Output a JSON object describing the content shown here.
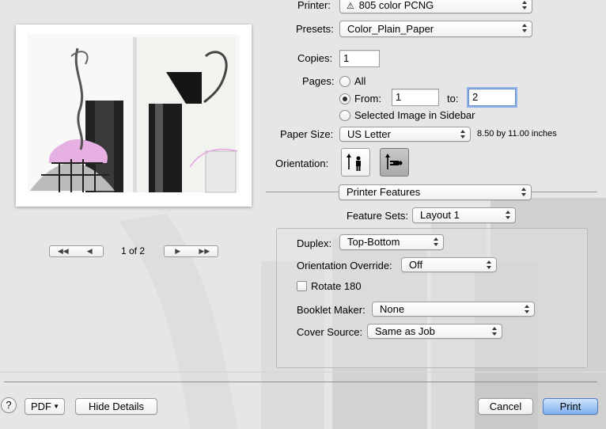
{
  "printer": {
    "label": "Printer:",
    "value": "805 color PCNG",
    "warning_icon": "warning-triangle-icon"
  },
  "presets": {
    "label": "Presets:",
    "value": "Color_Plain_Paper"
  },
  "copies": {
    "label": "Copies:",
    "value": "1"
  },
  "pages": {
    "label": "Pages:",
    "all_label": "All",
    "from_label": "From:",
    "from_value": "1",
    "to_label": "to:",
    "to_value": "2",
    "selected_label": "Selected Image in Sidebar",
    "selected_option": "from"
  },
  "paper_size": {
    "label": "Paper Size:",
    "value": "US Letter",
    "dimensions": "8.50 by 11.00 inches"
  },
  "orientation": {
    "label": "Orientation:",
    "options": [
      "portrait",
      "landscape"
    ],
    "selected": "landscape"
  },
  "section_popup": {
    "value": "Printer Features"
  },
  "feature_sets": {
    "label": "Feature Sets:",
    "value": "Layout 1"
  },
  "features": {
    "duplex_label": "Duplex:",
    "duplex_value": "Top-Bottom",
    "orientation_override_label": "Orientation Override:",
    "orientation_override_value": "Off",
    "rotate_label": "Rotate 180",
    "rotate_checked": false,
    "booklet_label": "Booklet Maker:",
    "booklet_value": "None",
    "cover_label": "Cover Source:",
    "cover_value": "Same as Job"
  },
  "preview": {
    "page_indicator": "1 of 2"
  },
  "footer": {
    "help_label": "?",
    "pdf_label": "PDF",
    "hide_details_label": "Hide Details",
    "cancel_label": "Cancel",
    "print_label": "Print"
  },
  "colors": {
    "default_button": "#7fb0ee",
    "focus_ring": "#8fb1ea",
    "dialog_bg": "#e8e8e8"
  }
}
